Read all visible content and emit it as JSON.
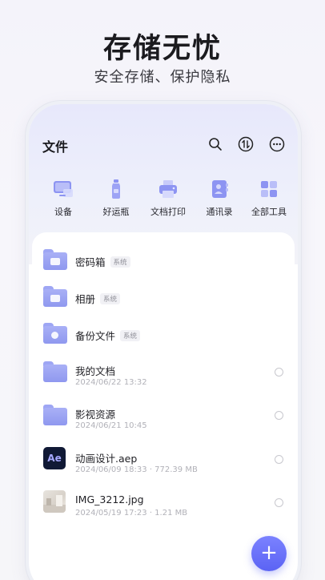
{
  "hero": {
    "title": "存储无忧",
    "subtitle": "安全存储、保护隐私"
  },
  "app": {
    "title": "文件",
    "header_icons": [
      "search-icon",
      "transfer-icon",
      "more-icon"
    ]
  },
  "tools": [
    {
      "label": "设备",
      "icon": "device-icon"
    },
    {
      "label": "好运瓶",
      "icon": "bottle-icon"
    },
    {
      "label": "文档打印",
      "icon": "printer-icon"
    },
    {
      "label": "通讯录",
      "icon": "contacts-icon"
    },
    {
      "label": "全部工具",
      "icon": "all-tools-icon"
    }
  ],
  "files": [
    {
      "name": "密码箱",
      "tag": "系统",
      "meta": "",
      "icon": "folder-lock-icon"
    },
    {
      "name": "相册",
      "tag": "系统",
      "meta": "",
      "icon": "folder-photo-icon"
    },
    {
      "name": "备份文件",
      "tag": "系统",
      "meta": "",
      "icon": "folder-backup-icon"
    },
    {
      "name": "我的文档",
      "tag": "",
      "meta": "2024/06/22 13:32",
      "icon": "folder-icon"
    },
    {
      "name": "影视资源",
      "tag": "",
      "meta": "2024/06/21 10:45",
      "icon": "folder-icon"
    },
    {
      "name": "动画设计.aep",
      "tag": "",
      "meta": "2024/06/09 18:33 · 772.39 MB",
      "icon": "after-effects-file-icon",
      "badge": "Ae"
    },
    {
      "name": "IMG_3212.jpg",
      "tag": "",
      "meta": "2024/05/19 17:23 · 1.21 MB",
      "icon": "image-thumbnail-icon"
    }
  ],
  "fab": {
    "label": "+"
  },
  "colors": {
    "accent": "#5b63f4",
    "folder": "#9ea6f4"
  }
}
